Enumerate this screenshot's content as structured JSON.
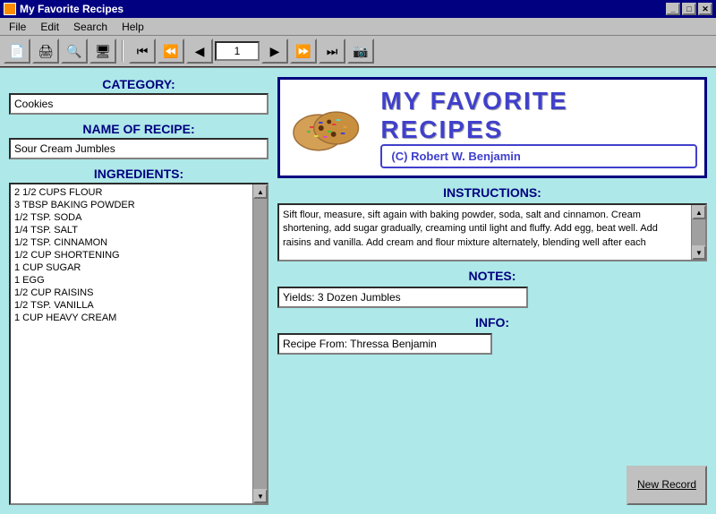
{
  "window": {
    "title": "My Favorite Recipes",
    "title_icon": "recipe-icon"
  },
  "menu": {
    "items": [
      "File",
      "Edit",
      "Search",
      "Help"
    ]
  },
  "toolbar": {
    "nav_value": "1",
    "buttons": [
      {
        "name": "first",
        "icon": "⏮"
      },
      {
        "name": "prev-fast",
        "icon": "⏪"
      },
      {
        "name": "prev",
        "icon": "◀"
      },
      {
        "name": "next",
        "icon": "▶"
      },
      {
        "name": "next-fast",
        "icon": "⏩"
      },
      {
        "name": "last",
        "icon": "⏭"
      },
      {
        "name": "camera",
        "icon": "📷"
      }
    ]
  },
  "left_panel": {
    "category_label": "CATEGORY:",
    "category_value": "Cookies",
    "name_label": "NAME OF RECIPE:",
    "name_value": "Sour Cream Jumbles",
    "ingredients_label": "INGREDIENTS:",
    "ingredients": [
      "2 1/2 CUPS FLOUR",
      "3 TBSP BAKING POWDER",
      "1/2 TSP. SODA",
      "1/4 TSP. SALT",
      "1/2 TSP. CINNAMON",
      "1/2 CUP SHORTENING",
      "1 CUP SUGAR",
      "1 EGG",
      "1/2 CUP RAISINS",
      "1/2 TSP. VANILLA",
      "1 CUP HEAVY CREAM"
    ]
  },
  "right_panel": {
    "app_title": "MY FAVORITE RECIPES",
    "copyright": "(C) Robert W. Benjamin",
    "instructions_label": "INSTRUCTIONS:",
    "instructions_text": "Sift flour, measure, sift again with baking powder, soda, salt and cinnamon. Cream shortening, add sugar gradually, creaming until light and fluffy. Add egg, beat well. Add raisins and vanilla. Add cream and flour mixture alternately, blending well after each",
    "notes_label": "NOTES:",
    "notes_value": "Yields: 3 Dozen Jumbles",
    "info_label": "INFO:",
    "info_value": "Recipe From: Thressa Benjamin",
    "new_record_label": "New Record"
  }
}
